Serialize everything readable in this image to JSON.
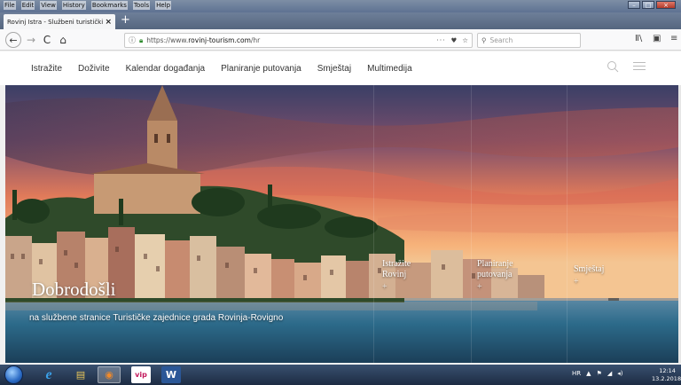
{
  "window": {
    "menu": [
      "File",
      "Edit",
      "View",
      "History",
      "Bookmarks",
      "Tools",
      "Help"
    ]
  },
  "tab": {
    "title": "Rovinj Istra - Službeni turistički por",
    "close": "×",
    "new_tab": "+"
  },
  "nav": {
    "back": "←",
    "forward": "→",
    "reload": "C",
    "home": "⌂",
    "url_prefix": "https://www.",
    "url_domain": "rovinj-tourism.com",
    "url_path": "/hr",
    "more": "···",
    "search_placeholder": "Search"
  },
  "site": {
    "nav_items": [
      "Istražite",
      "Doživite",
      "Kalendar događanja",
      "Planiranje putovanja",
      "Smještaj",
      "Multimedija"
    ],
    "hero_title": "Dobrodošli",
    "hero_subtitle": "na službene stranice Turističke zajednice grada Rovinja-Rovigno",
    "hero_links": [
      {
        "line1": "Istražite",
        "line2": "Rovinj"
      },
      {
        "line1": "Planiranje",
        "line2": "putovanja"
      },
      {
        "line1": "Smještaj",
        "line2": ""
      }
    ]
  },
  "taskbar": {
    "apps": [
      "e",
      "▤",
      "◉",
      "vip",
      "W"
    ],
    "lang": "HR",
    "time": "12:14",
    "date": "13.2.2018."
  },
  "colors": {
    "sky_top": "#3a3f66",
    "sky_glow": "#f08a5a",
    "sea": "#2c6a8a",
    "accent_green": "#2e8b2e"
  }
}
